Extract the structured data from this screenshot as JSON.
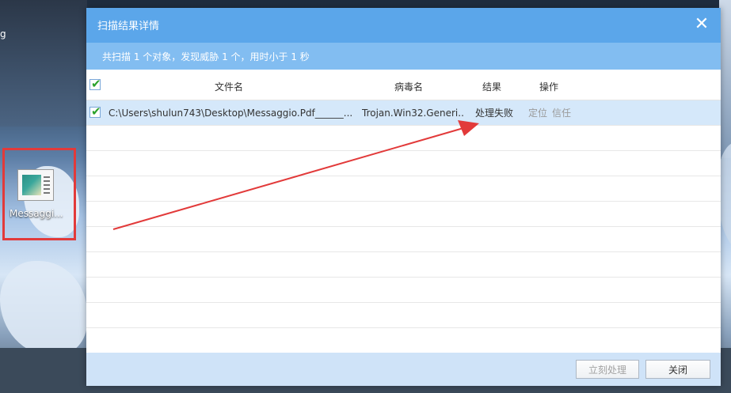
{
  "desktop": {
    "side_label": "g",
    "icon_label": "Messaggi..."
  },
  "dialog": {
    "title": "扫描结果详情",
    "summary": "共扫描 1 个对象，发现威胁 1 个，用时小于 1 秒",
    "columns": {
      "file": "文件名",
      "virus": "病毒名",
      "result": "结果",
      "action": "操作"
    },
    "rows": [
      {
        "file": "C:\\Users\\shulun743\\Desktop\\Messaggio.Pdf______...",
        "virus": "Trojan.Win32.Generi...",
        "result": "处理失败",
        "action_locate": "定位",
        "action_trust": "信任"
      }
    ],
    "buttons": {
      "process": "立刻处理",
      "close": "关闭"
    }
  },
  "colors": {
    "titlebar": "#5ba6ea",
    "summary": "#82bdf1",
    "selected_row": "#d5e8fa",
    "annotation": "#e23a3a"
  }
}
